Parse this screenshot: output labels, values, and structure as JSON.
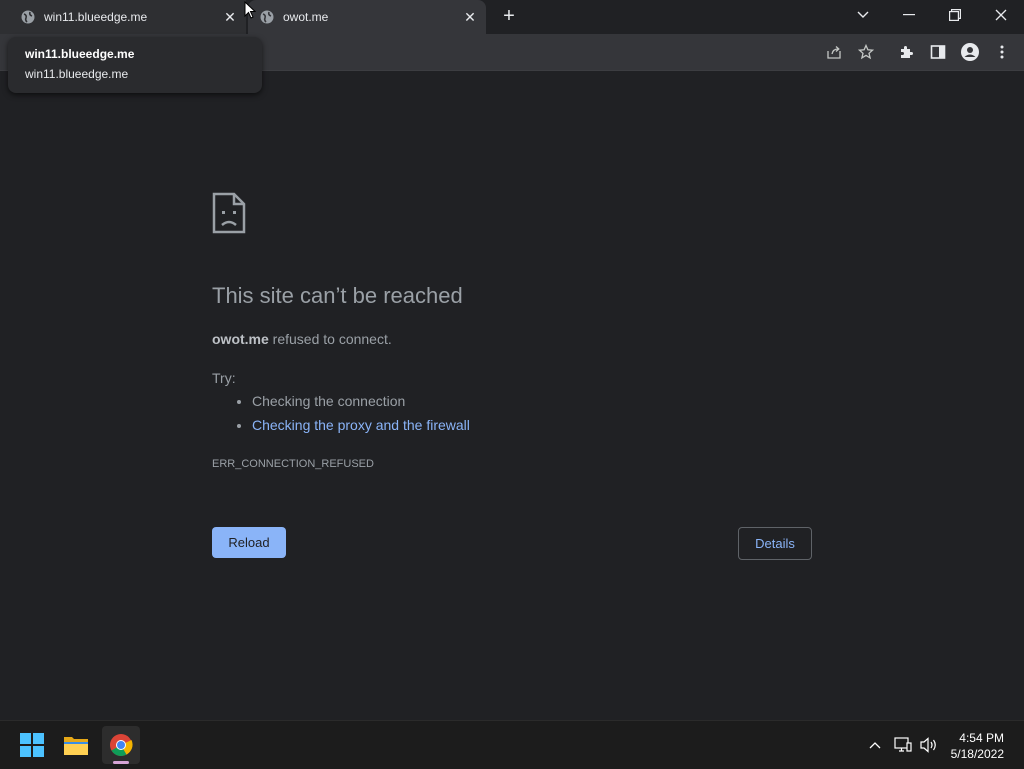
{
  "browser": {
    "tabs": [
      {
        "title": "win11.blueedge.me",
        "favicon": "globe-icon",
        "close": "✕"
      },
      {
        "title": "owot.me",
        "favicon": "globe-icon",
        "close": "✕"
      }
    ],
    "new_tab": "+",
    "window_controls": {
      "tab_search": "⌄",
      "minimize": "—",
      "restore": "❐",
      "close": "✕"
    },
    "hover_card": {
      "title": "win11.blueedge.me",
      "url": "win11.blueedge.me"
    },
    "toolbar_icons": [
      "share-icon",
      "star-icon",
      "extensions-icon",
      "side-panel-icon",
      "profile-icon",
      "menu-icon"
    ]
  },
  "error_page": {
    "heading": "This site can’t be reached",
    "host": "owot.me",
    "host_suffix": " refused to connect.",
    "try_label": "Try:",
    "suggestions": [
      {
        "text": "Checking the connection",
        "is_link": false
      },
      {
        "text": "Checking the proxy and the firewall",
        "is_link": true
      }
    ],
    "error_code": "ERR_CONNECTION_REFUSED",
    "reload_label": "Reload",
    "details_label": "Details"
  },
  "taskbar": {
    "apps": [
      "windows-start-icon",
      "file-explorer-icon",
      "chrome-icon"
    ],
    "tray": [
      "chevron-up-icon",
      "network-icon",
      "volume-icon"
    ],
    "time": "4:54 PM",
    "date": "5/18/2022"
  },
  "colors": {
    "background": "#202124",
    "link": "#8ab4f8",
    "reload_bg": "#8ab4f8",
    "text_secondary": "#9aa0a6"
  }
}
